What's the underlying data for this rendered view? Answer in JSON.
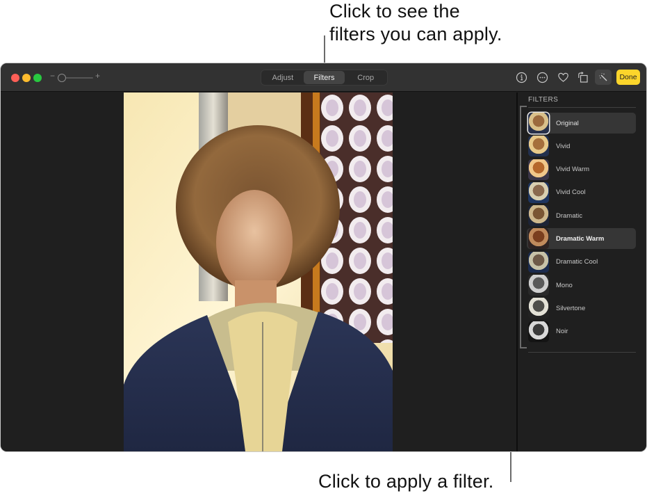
{
  "callouts": {
    "top_line1": "Click to see the",
    "top_line2": "filters you can apply.",
    "bottom": "Click to apply a filter."
  },
  "window": {
    "traffic_lights": [
      "close",
      "minimize",
      "zoom"
    ],
    "zoom_slider": {
      "minus": "−",
      "plus": "+",
      "value": 0.05
    },
    "tabs": [
      {
        "label": "Adjust",
        "active": false
      },
      {
        "label": "Filters",
        "active": true
      },
      {
        "label": "Crop",
        "active": false
      }
    ],
    "toolbar_icons": [
      "info-icon",
      "more-icon",
      "favorite-heart-icon",
      "rotate-icon",
      "auto-enhance-icon"
    ],
    "done_label": "Done",
    "colors": {
      "accent_done": "#fcd52b",
      "toolbar_bg": "#323232",
      "window_bg": "#1f1f1f"
    }
  },
  "sidebar": {
    "title": "FILTERS",
    "filters": [
      {
        "label": "Original",
        "selected": true,
        "tone": "color"
      },
      {
        "label": "Vivid",
        "selected": false,
        "tone": "color"
      },
      {
        "label": "Vivid Warm",
        "selected": false,
        "tone": "warm"
      },
      {
        "label": "Vivid Cool",
        "selected": false,
        "tone": "cool"
      },
      {
        "label": "Dramatic",
        "selected": false,
        "tone": "dramatic"
      },
      {
        "label": "Dramatic Warm",
        "selected": true,
        "tone": "dramatic-warm"
      },
      {
        "label": "Dramatic Cool",
        "selected": false,
        "tone": "dramatic-cool"
      },
      {
        "label": "Mono",
        "selected": false,
        "tone": "mono"
      },
      {
        "label": "Silvertone",
        "selected": false,
        "tone": "silver"
      },
      {
        "label": "Noir",
        "selected": false,
        "tone": "noir"
      }
    ]
  }
}
